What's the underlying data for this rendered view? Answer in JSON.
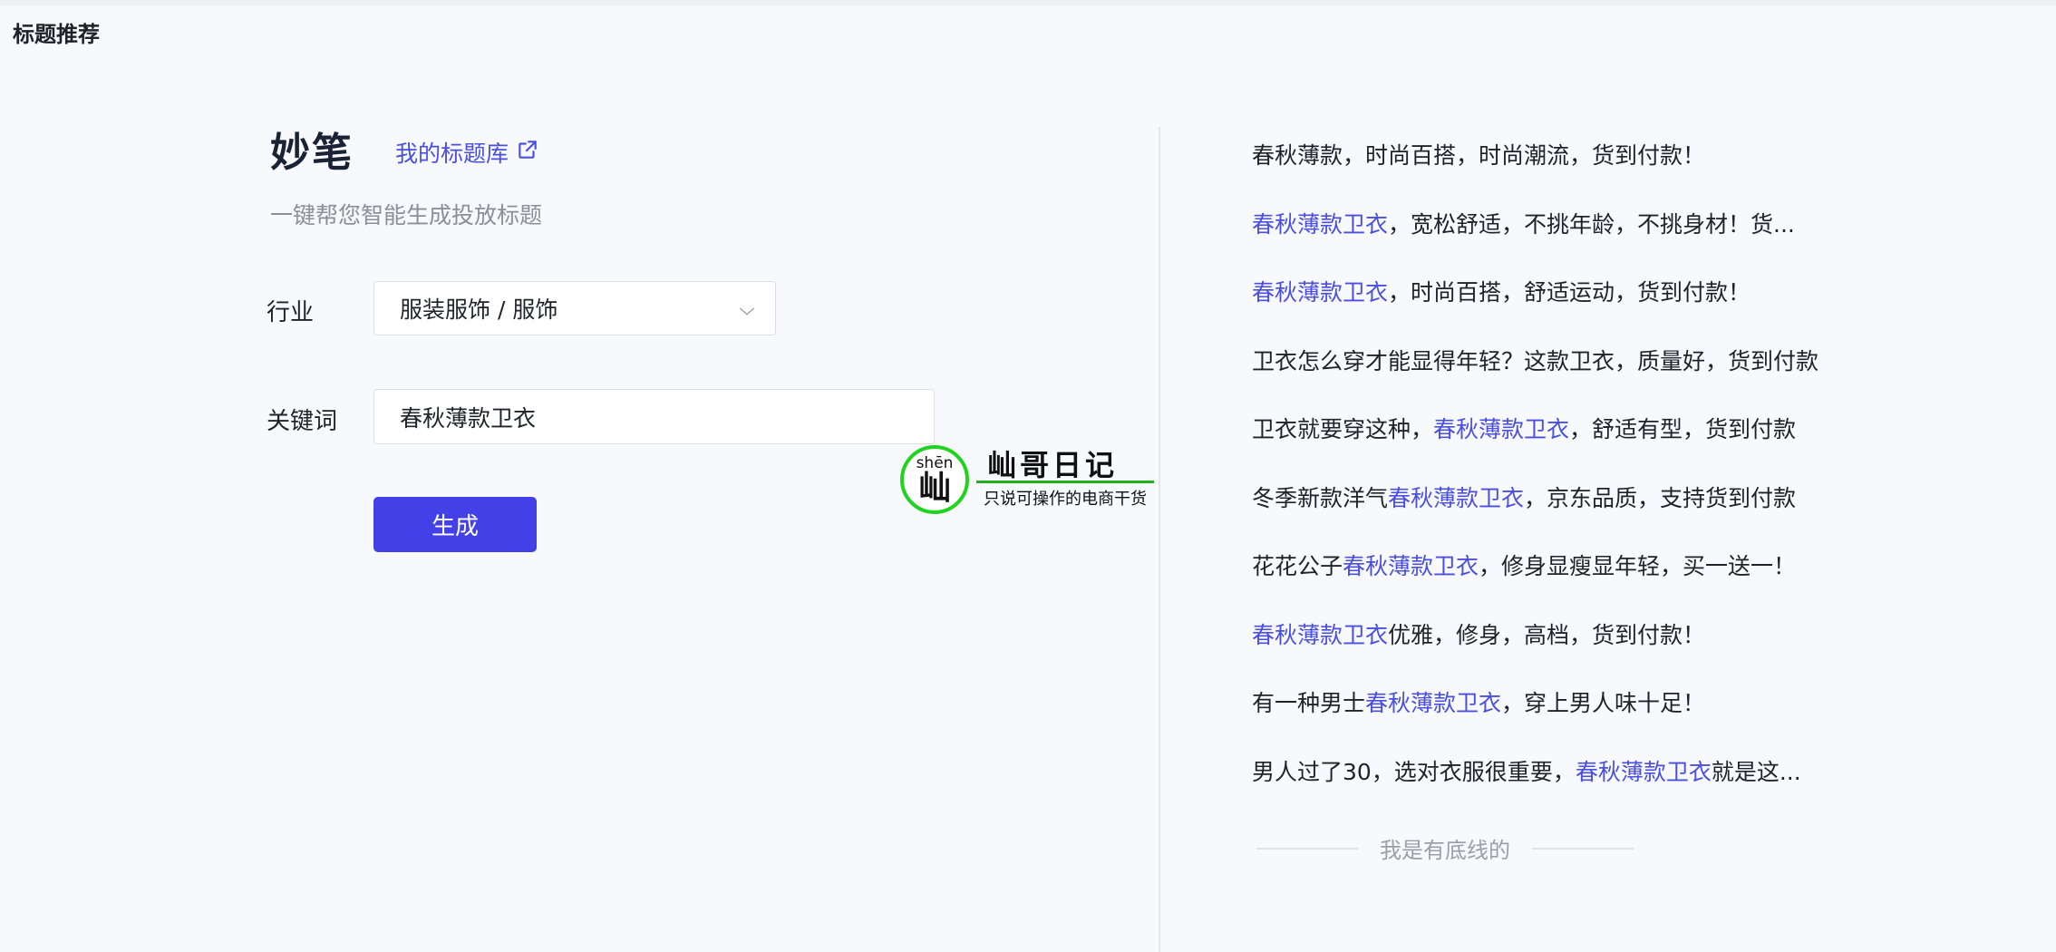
{
  "header": {
    "page_title": "标题推荐"
  },
  "brand": {
    "name": "妙笔",
    "library_link": "我的标题库",
    "library_icon": "external-link-icon",
    "subtitle": "一键帮您智能生成投放标题"
  },
  "form": {
    "industry_label": "行业",
    "industry_value": "服装服饰 / 服饰",
    "keyword_label": "关键词",
    "keyword_value": "春秋薄款卫衣",
    "generate_label": "生成"
  },
  "watermark": {
    "pinyin": "shēn",
    "glyph": "屾",
    "name": "屾哥日记",
    "slogan": "只说可操作的电商干货"
  },
  "results": [
    {
      "segments": [
        {
          "text": "春秋薄款，时尚百搭，时尚潮流，货到付款！",
          "hl": false
        }
      ]
    },
    {
      "segments": [
        {
          "text": "春秋薄款卫衣",
          "hl": true
        },
        {
          "text": "，宽松舒适，不挑年龄，不挑身材！货...",
          "hl": false
        }
      ]
    },
    {
      "segments": [
        {
          "text": "春秋薄款卫衣",
          "hl": true
        },
        {
          "text": "，时尚百搭，舒适运动，货到付款！",
          "hl": false
        }
      ]
    },
    {
      "segments": [
        {
          "text": "卫衣怎么穿才能显得年轻？这款卫衣，质量好，货到付款",
          "hl": false
        }
      ]
    },
    {
      "segments": [
        {
          "text": "卫衣就要穿这种，",
          "hl": false
        },
        {
          "text": "春秋薄款卫衣",
          "hl": true
        },
        {
          "text": "，舒适有型，货到付款",
          "hl": false
        }
      ]
    },
    {
      "segments": [
        {
          "text": "冬季新款洋气",
          "hl": false
        },
        {
          "text": "春秋薄款卫衣",
          "hl": true
        },
        {
          "text": "，京东品质，支持货到付款",
          "hl": false
        }
      ]
    },
    {
      "segments": [
        {
          "text": "花花公子",
          "hl": false
        },
        {
          "text": "春秋薄款卫衣",
          "hl": true
        },
        {
          "text": "，修身显瘦显年轻，买一送一！",
          "hl": false
        }
      ]
    },
    {
      "segments": [
        {
          "text": "春秋薄款卫衣",
          "hl": true
        },
        {
          "text": "优雅，修身，高档，货到付款！",
          "hl": false
        }
      ]
    },
    {
      "segments": [
        {
          "text": "有一种男士",
          "hl": false
        },
        {
          "text": "春秋薄款卫衣",
          "hl": true
        },
        {
          "text": "，穿上男人味十足！",
          "hl": false
        }
      ]
    },
    {
      "segments": [
        {
          "text": "男人过了30，选对衣服很重要，",
          "hl": false
        },
        {
          "text": "春秋薄款卫衣",
          "hl": true
        },
        {
          "text": "就是这...",
          "hl": false
        }
      ]
    }
  ],
  "end_text": "我是有底线的",
  "colors": {
    "accent": "#4340e8",
    "highlight": "#4a4fe0",
    "logo_green": "#1fd31f"
  }
}
